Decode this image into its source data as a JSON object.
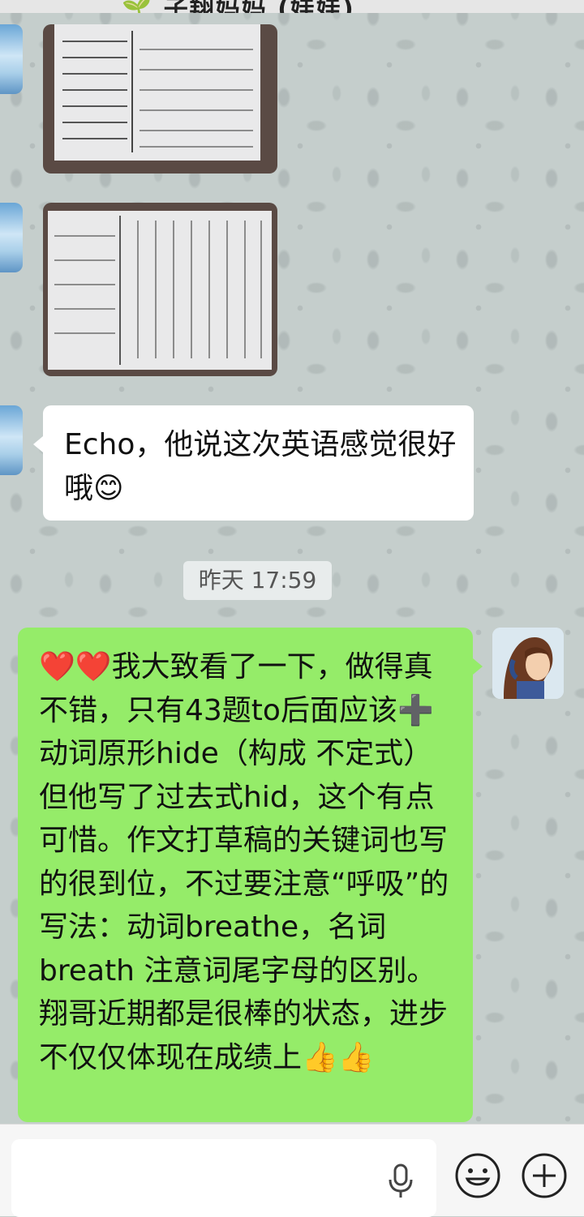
{
  "header": {
    "title": "🌱 子翔妈妈 (娃娃)"
  },
  "messages": {
    "incoming_text": "Echo，他说这次英语感觉很好哦😊",
    "timestamp": "昨天 17:59",
    "outgoing_text": "❤️❤️我大致看了一下，做得真不错，只有43题to后面应该➕动词原形hide（构成 不定式）但他写了过去式hid，这个有点可惜。作文打草稿的关键词也写的很到位，不过要注意“呼吸”的写法：动词breathe，名词breath 注意词尾字母的区别。翔哥近期都是很棒的状态，进步不仅仅体现在成绩上👍👍"
  },
  "input": {
    "placeholder": ""
  },
  "colors": {
    "outgoing_bubble": "#95ec69",
    "incoming_bubble": "#ffffff",
    "wallpaper": "#c5cecc"
  },
  "icons": [
    "voice-icon",
    "emoji-icon",
    "plus-icon"
  ]
}
